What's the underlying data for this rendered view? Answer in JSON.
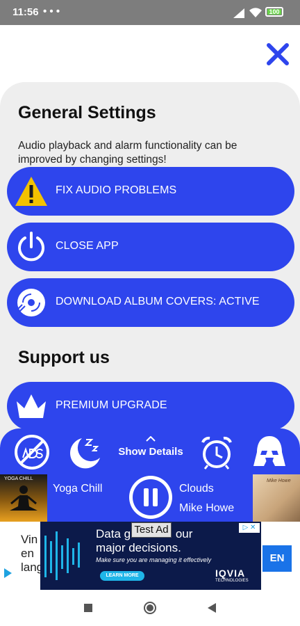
{
  "status_bar": {
    "time": "11:56",
    "extra_icons": "• • •",
    "battery": "100"
  },
  "close_button": {
    "icon": "close-icon",
    "color": "#2e45ed"
  },
  "general_settings": {
    "heading": "General Settings",
    "description": "Audio playback and alarm functionality can be improved by changing settings!",
    "buttons": [
      {
        "label": "FIX AUDIO PROBLEMS",
        "icon": "warning-icon"
      },
      {
        "label": "CLOSE APP",
        "icon": "power-icon"
      },
      {
        "label": "DOWNLOAD ALBUM COVERS: ACTIVE",
        "icon": "disc-download-icon"
      }
    ]
  },
  "support": {
    "heading": "Support us",
    "buttons": [
      {
        "label": "PREMIUM UPGRADE",
        "icon": "crown-icon"
      }
    ]
  },
  "bottom_bar": {
    "show_details": "Show Details",
    "icons": [
      "no-ads-icon",
      "sleep-moon-icon",
      "alarm-clock-icon",
      "vader-helmet-icon"
    ]
  },
  "player": {
    "left_track": "Yoga Chill",
    "left_thumb_caption": "YOGA CHILL",
    "right_thumb_caption": "Mike Howe",
    "title": "Clouds",
    "artist": "Mike Howe"
  },
  "ad": {
    "badge": "Test Ad",
    "left_text_lines": [
      "Vin",
      "en",
      "lang"
    ],
    "headline_lines": [
      "Data g",
      "our",
      "major decisions."
    ],
    "tagline": "Make sure you are managing it effectively",
    "cta": "LEARN MORE",
    "brand": "IQVIA",
    "brand_sub": "TECHNOLOGIES",
    "right_button": "EN"
  },
  "colors": {
    "accent": "#2e45ed",
    "panel_bg": "#eeeeee",
    "status_bg": "#7d7d7d"
  }
}
